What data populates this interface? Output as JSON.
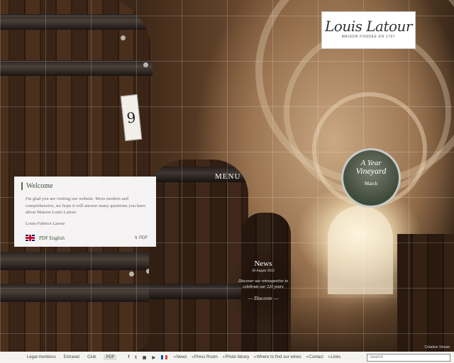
{
  "logo": {
    "name": "Louis Latour",
    "tagline": "MAISON FONDÉE EN 1797"
  },
  "menu_label": "MENU",
  "barrel_tag": "9",
  "welcome": {
    "title": "Welcome",
    "body": "I'm glad you are visiting our website. More modern and comprehensive, we hope it will answer many questions you have about Maison Louis Latour.",
    "signature": "Louis-Fabrice Latour",
    "pdf_language": "PDF English",
    "pdf_label": "PDF"
  },
  "vineyard_badge": {
    "line1": "A Year",
    "line2": "Vineyard",
    "month": "March"
  },
  "news": {
    "title": "News",
    "date": "30 August 2012",
    "text": "Discover our retrospective to celebrate our 220 years",
    "link": "Discover"
  },
  "credit": "Création Vinium",
  "footer": {
    "legal": "Legal mentions",
    "extranet": "Extranet",
    "club": "Club",
    "pdf": "PDF",
    "social": [
      "f",
      "t",
      "ig",
      "yt"
    ],
    "links": [
      "News",
      "Press Room",
      "Photo library",
      "Where to find our wines",
      "Contact",
      "Links"
    ],
    "search_placeholder": "Search"
  },
  "colors": {
    "accent_green": "#3b4b3b",
    "footer_bg": "#f4f3ef"
  }
}
